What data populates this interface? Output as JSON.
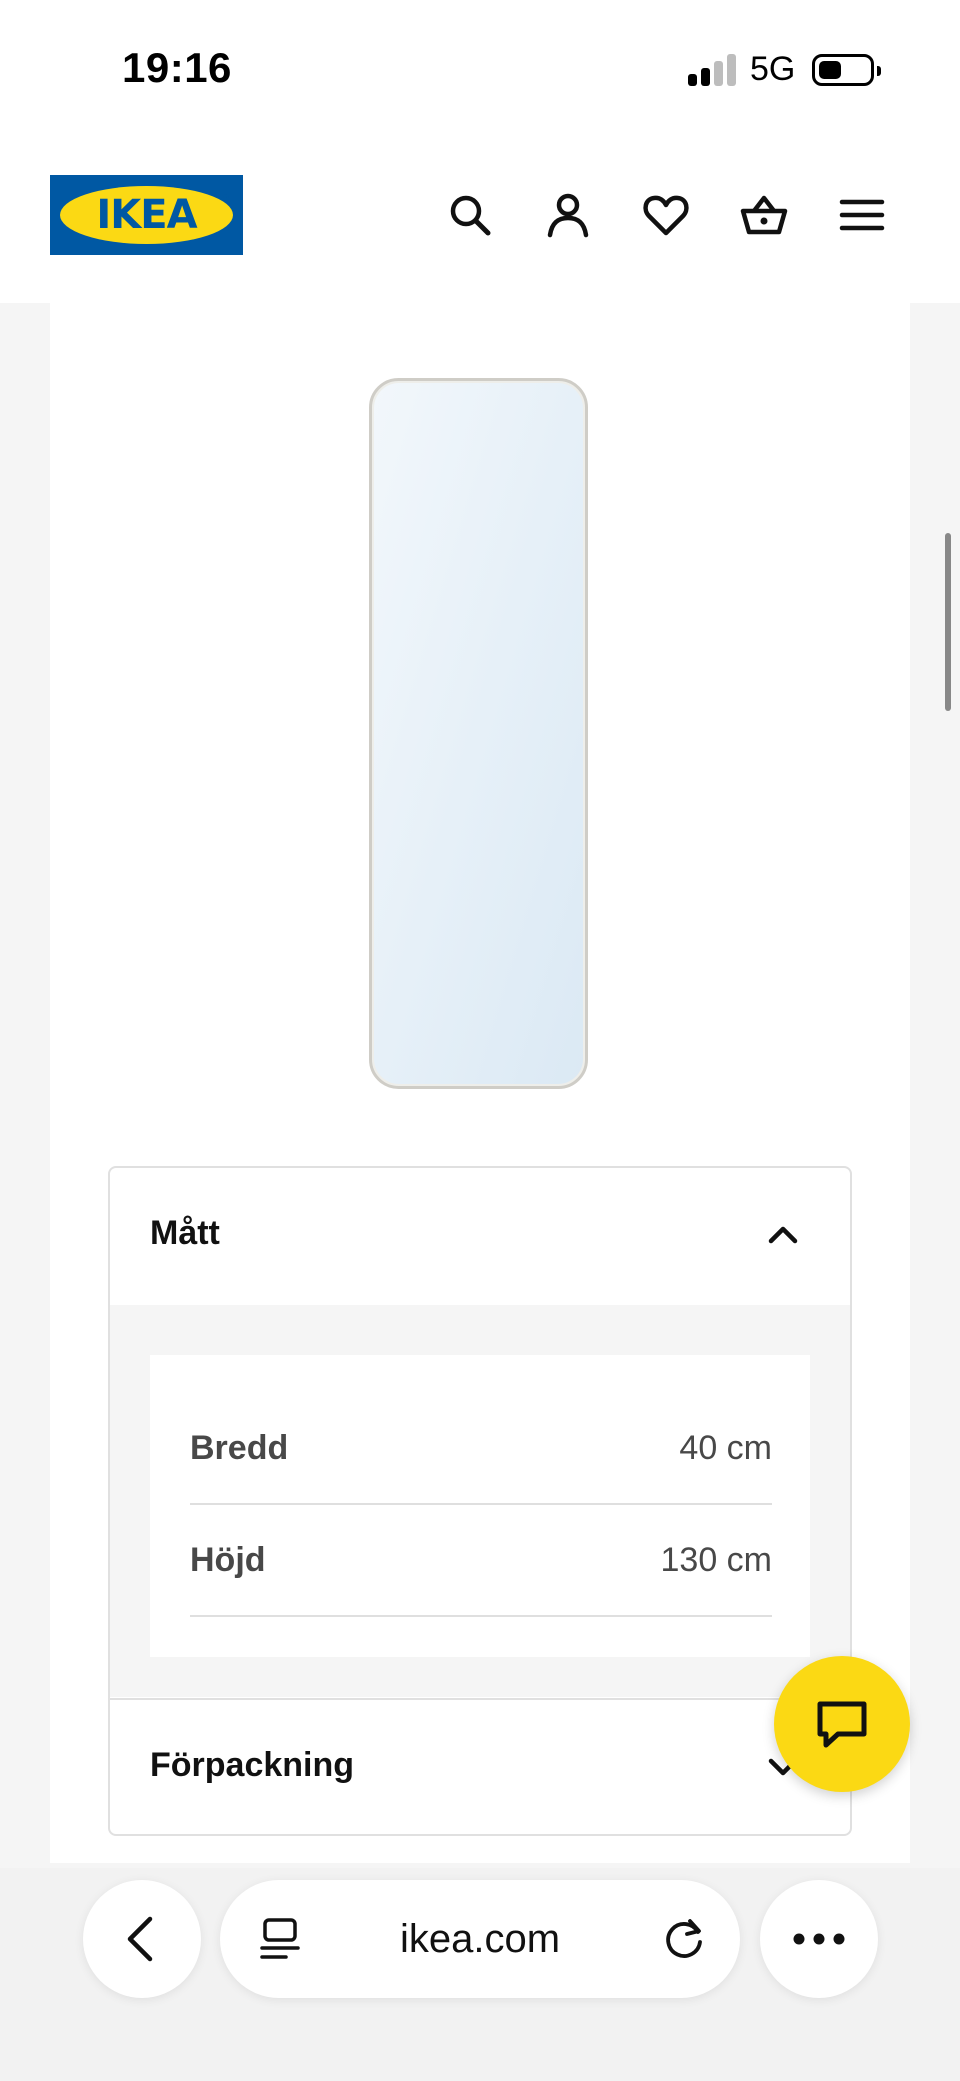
{
  "status_bar": {
    "time": "19:16",
    "network": "5G"
  },
  "header": {
    "logo_text": "IKEA",
    "icons": [
      "search-icon",
      "account-icon",
      "heart-icon",
      "basket-icon",
      "menu-icon"
    ]
  },
  "product": {
    "image": "mirror"
  },
  "accordion": {
    "dimensions": {
      "title": "Mått",
      "expanded": true,
      "rows": [
        {
          "label": "Bredd",
          "value": "40 cm"
        },
        {
          "label": "Höjd",
          "value": "130 cm"
        }
      ]
    },
    "packaging": {
      "title": "Förpackning",
      "expanded": false
    }
  },
  "chat": {
    "icon": "chat-icon",
    "color": "#fbd914"
  },
  "browser": {
    "url": "ikea.com",
    "icons": [
      "back-icon",
      "tabs-icon",
      "reload-icon",
      "more-icon"
    ]
  },
  "colors": {
    "brand_blue": "#0058a3",
    "brand_yellow": "#fbd914"
  }
}
